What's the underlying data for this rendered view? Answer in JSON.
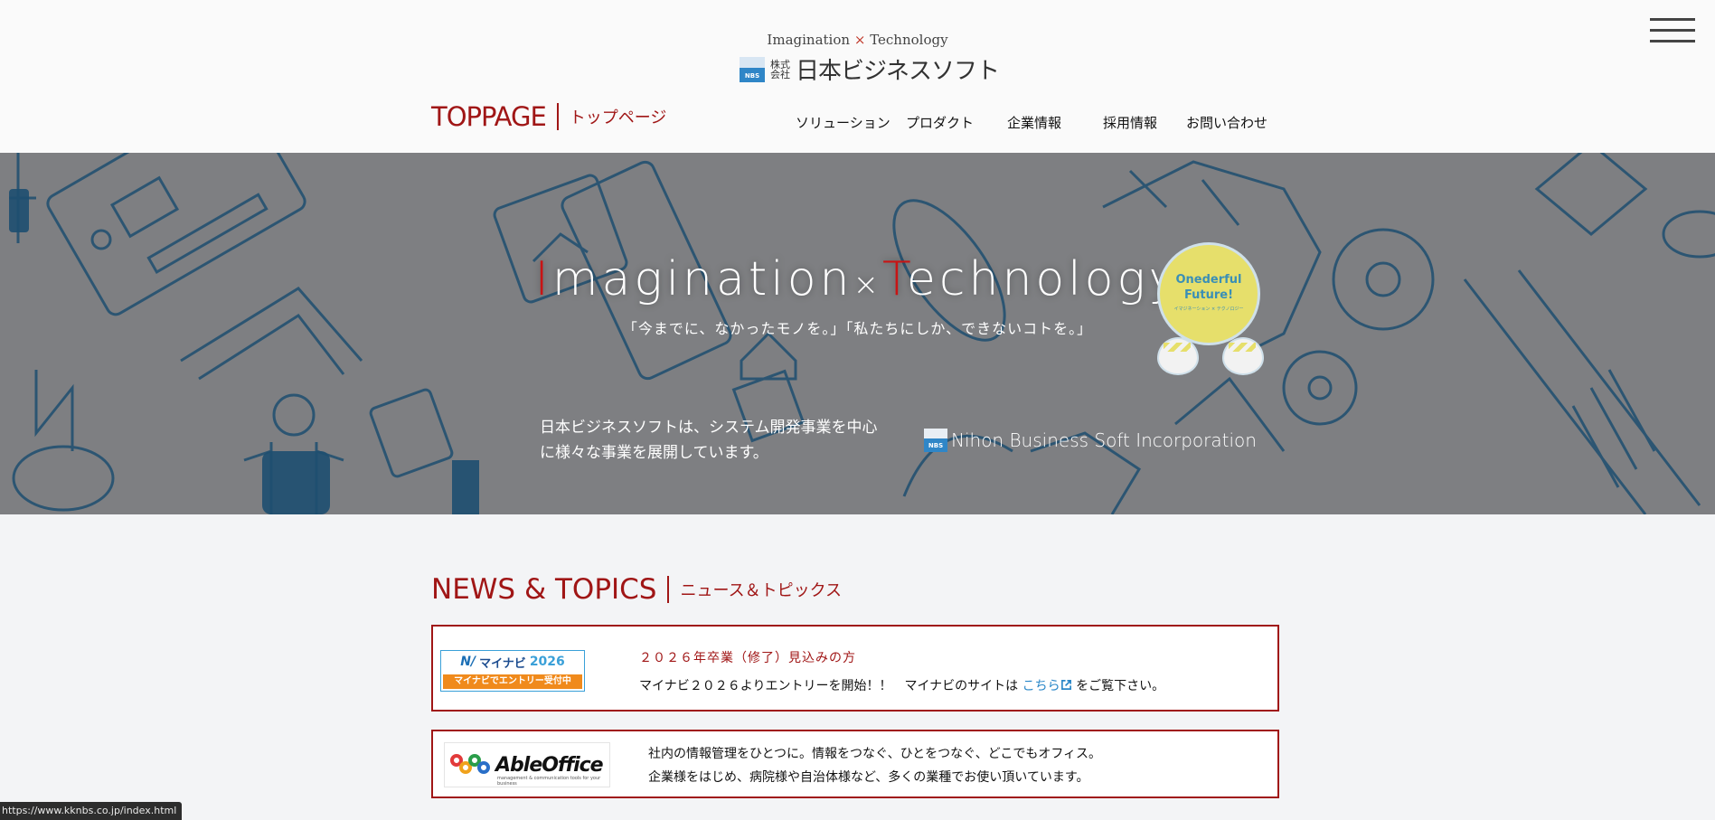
{
  "header": {
    "tagline": {
      "left": "Imagination",
      "x": "×",
      "right": "Technology"
    },
    "logo_mark": "NBS",
    "logo_kabu": "株式会社",
    "logo_name": "日本ビジネスソフト",
    "page_title_en": "TOPPAGE",
    "page_title_jp": "トップページ",
    "menu_icon": "hamburger-icon"
  },
  "nav": {
    "items": [
      {
        "label": "ソリューション"
      },
      {
        "label": "プロダクト"
      },
      {
        "label": "企業情報"
      },
      {
        "label": "採用情報"
      },
      {
        "label": "お問い合わせ"
      }
    ]
  },
  "hero": {
    "title": {
      "i": "I",
      "rest1": "magination",
      "x": "×",
      "t": "T",
      "rest2": "echnology"
    },
    "subtitle": "「今までに、なかったモノを。」「私たちにしか、できないコトを。」",
    "desc_line1": "日本ビジネスソフトは、システム開発事業を中心",
    "desc_line2": "に様々な事業を展開しています。",
    "brand_mark": "NBS",
    "brand_text": "Nihon Business Soft Incorporation",
    "badge_line1": "Onederful",
    "badge_line2": "Future!",
    "badge_small": "イマジネーション × テクノロジー"
  },
  "news": {
    "title_en": "NEWS & TOPICS",
    "title_jp": "ニュース＆トピックス",
    "items": [
      {
        "banner_brand": "マイナビ",
        "banner_year": "2026",
        "banner_sub": "マイナビでエントリー受付中",
        "title": "２０２６年卒業（修了）見込みの方",
        "body_before": "マイナビ２０２６よりエントリーを開始！！　マイナビのサイトは",
        "link": "こちら",
        "body_after": "をご覧下さい。"
      },
      {
        "banner_brand": "AbleOffice",
        "banner_sub": "management & communication tools for your business",
        "line1": "社内の情報管理をひとつに。情報をつなぐ、ひとをつなぐ、どこでもオフィス。",
        "line2": "企業様をはじめ、病院様や自治体様など、多くの業種でお使い頂いています。"
      }
    ]
  },
  "status": {
    "url": "https://www.kknbs.co.jp/index.html"
  },
  "colors": {
    "accent": "#a01616",
    "link": "#2a87c8",
    "hero_bg": "#7e7f82"
  }
}
